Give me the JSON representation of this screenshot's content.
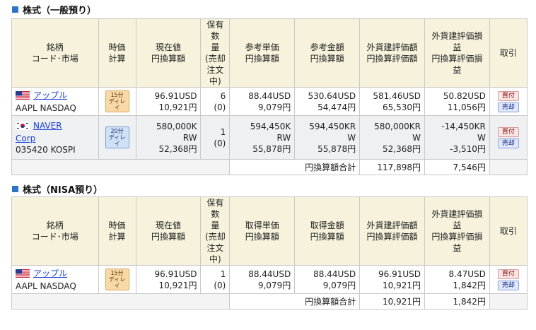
{
  "sections": [
    {
      "title": "株式（一般預り）",
      "headers": [
        "銘柄\nコード･市場",
        "時価\n計算",
        "現在値\n円換算額",
        "保有数\n量\n(売却\n注文\n中)",
        "参考単価\n円換算額",
        "参考金額\n円換算額",
        "外貨建評価額\n円換算評価額",
        "外貨建評価損益\n円換算評価損益",
        "取引"
      ],
      "rows": [
        {
          "flag": "us-flag-icon",
          "name": "アップル",
          "code": "AAPL NASDAQ",
          "delay": "15分\nディレイ",
          "price": "96.91USD\n10,921円",
          "qty": "6\n(0)",
          "unit": "88.44USD\n9,079円",
          "amount": "530.64USD\n54,474円",
          "valuation": "581.46USD\n65,530円",
          "pl": "50.82USD\n11,056円",
          "buy": "買付",
          "sell": "売却"
        },
        {
          "flag": "kr-flag-icon",
          "name": "NAVER\nCorp",
          "code": "035420 KOSPI",
          "delay": "20分\nディレイ",
          "price": "580,000K\nRW\n52,368円",
          "qty": "1\n(0)",
          "unit": "594,450K\nRW\n55,878円",
          "amount": "594,450KR\nW\n55,878円",
          "valuation": "580,000KR\nW\n52,368円",
          "pl": "-14,450KR\nW\n-3,510円",
          "buy": "買付",
          "sell": "売却"
        }
      ],
      "total_label": "円換算額合計",
      "total_valuation": "117,898円",
      "total_pl": "7,546円"
    },
    {
      "title": "株式（NISA預り）",
      "headers": [
        "銘柄\nコード･市場",
        "時価\n計算",
        "現在値\n円換算額",
        "保有数\n量\n(売却\n注文\n中)",
        "取得単価\n円換算額",
        "取得金額\n円換算額",
        "外貨建評価額\n円換算評価額",
        "外貨建評価損益\n円換算評価損益",
        "取引"
      ],
      "rows": [
        {
          "flag": "us-flag-icon",
          "name": "アップル",
          "code": "AAPL NASDAQ",
          "delay": "15分\nディレイ",
          "price": "96.91USD\n10,921円",
          "qty": "1\n(0)",
          "unit": "88.44USD\n9,079円",
          "amount": "88.44USD\n9,079円",
          "valuation": "96.91USD\n10,921円",
          "pl": "8.47USD\n1,842円",
          "buy": "買付",
          "sell": "売却"
        }
      ],
      "total_label": "円換算額合計",
      "total_valuation": "10,921円",
      "total_pl": "1,842円"
    }
  ]
}
